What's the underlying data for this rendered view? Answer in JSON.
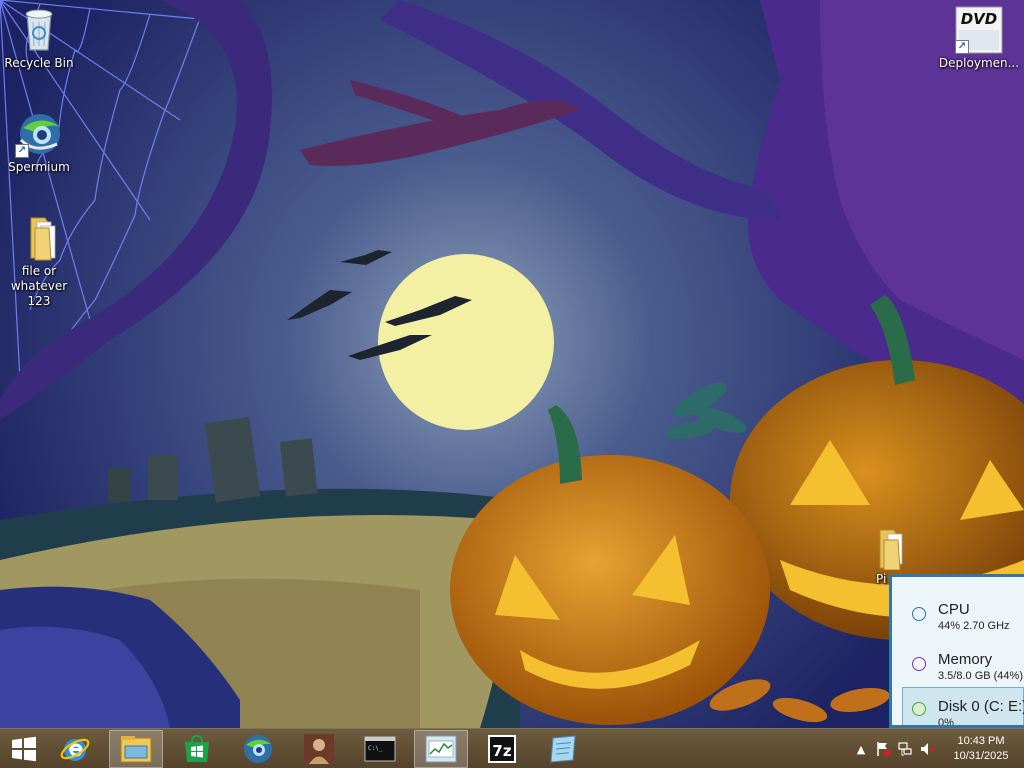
{
  "desktop": {
    "icons": [
      {
        "label": "Recycle Bin",
        "icon": "recycle-bin-icon"
      },
      {
        "label": "Spermium",
        "icon": "globe-app-icon"
      },
      {
        "label": "file or whatever 123",
        "icon": "folder-icon"
      },
      {
        "label": "Deploymen...",
        "icon": "dvd-icon"
      },
      {
        "label": "Pi",
        "icon": "folder-icon"
      }
    ]
  },
  "performance_panel": {
    "items": [
      {
        "title": "CPU",
        "value": "44%  2.70 GHz",
        "color": "#1f77b4",
        "selected": false
      },
      {
        "title": "Memory",
        "value": "3.5/8.0 GB (44%)",
        "color": "#8b2fa8",
        "selected": false
      },
      {
        "title": "Disk 0 (C: E:)",
        "value": "0%",
        "color": "#4aa83a",
        "selected": true
      }
    ]
  },
  "taskbar": {
    "start_icon": "windows-logo-icon",
    "buttons": [
      {
        "icon": "internet-explorer-icon",
        "active": false
      },
      {
        "icon": "file-explorer-icon",
        "active": true
      },
      {
        "icon": "windows-store-icon",
        "active": false
      },
      {
        "icon": "globe-app-icon",
        "active": false
      },
      {
        "icon": "photo-app-icon",
        "active": false
      },
      {
        "icon": "command-prompt-icon",
        "active": false
      },
      {
        "icon": "task-manager-icon",
        "active": true
      },
      {
        "icon": "7zip-icon",
        "active": false
      },
      {
        "icon": "notepad-icon",
        "active": false
      }
    ],
    "tray": {
      "clock_time": "10:43 PM",
      "clock_date": "10/31/2025"
    }
  },
  "colors": {
    "taskbar": "#6e5a36",
    "panel_border": "#2f77a8",
    "moon": "#f3f0a4"
  }
}
